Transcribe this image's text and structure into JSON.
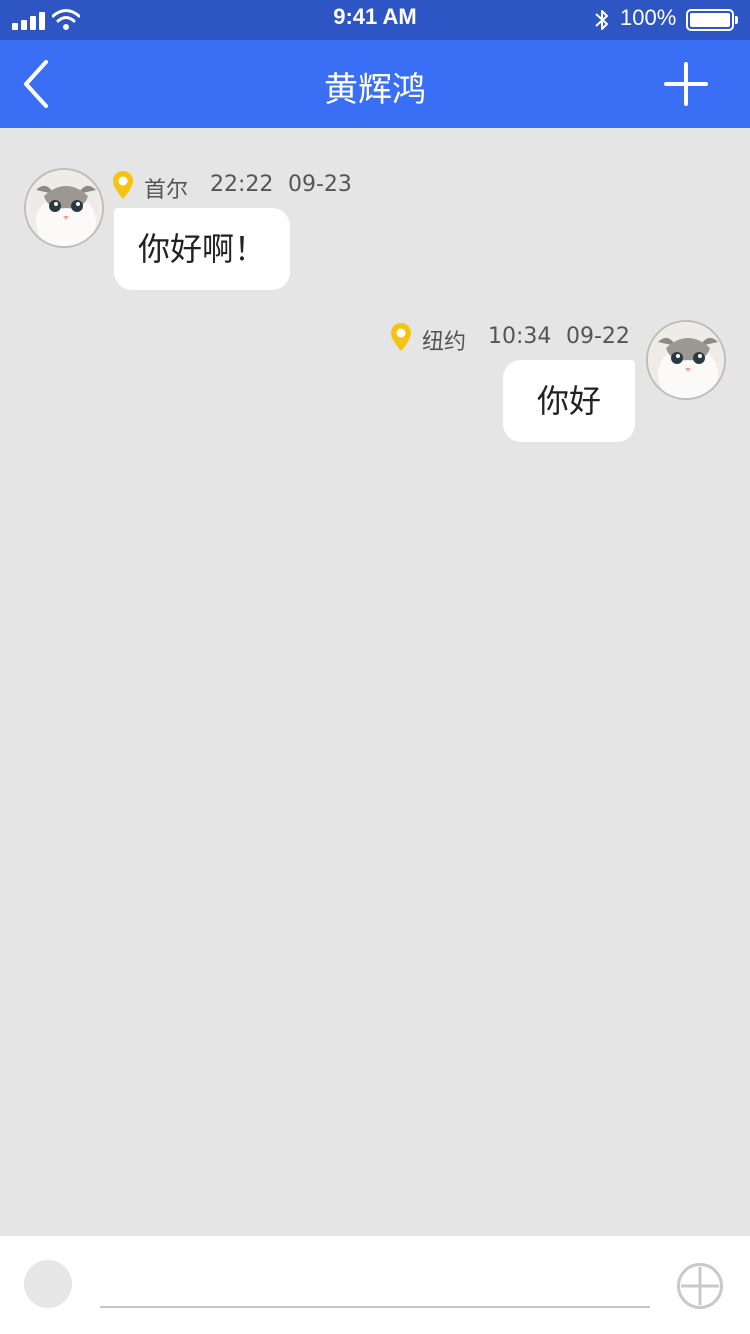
{
  "status_bar": {
    "time": "9:41 AM",
    "battery_pct": "100%",
    "battery_level": 1.0,
    "icons": [
      "signal-icon",
      "wifi-icon",
      "bluetooth-icon",
      "battery-icon"
    ]
  },
  "nav": {
    "title": "黄辉鸿",
    "back_icon": "chevron-left-icon",
    "add_icon": "plus-icon"
  },
  "messages": [
    {
      "side": "left",
      "location": "首尔",
      "time": "22:22",
      "date": "09-23",
      "text": "你好啊！"
    },
    {
      "side": "right",
      "location": "纽约",
      "time": "10:34",
      "date": "09-22",
      "text": "你好"
    }
  ],
  "input_bar": {
    "value": "",
    "more_icon": "plus-circle-icon"
  },
  "colors": {
    "status_bar": "#2d55c4",
    "nav_bar": "#3a6ff5",
    "background": "#e5e5e5",
    "pin": "#f7c313",
    "bubble": "#ffffff"
  }
}
